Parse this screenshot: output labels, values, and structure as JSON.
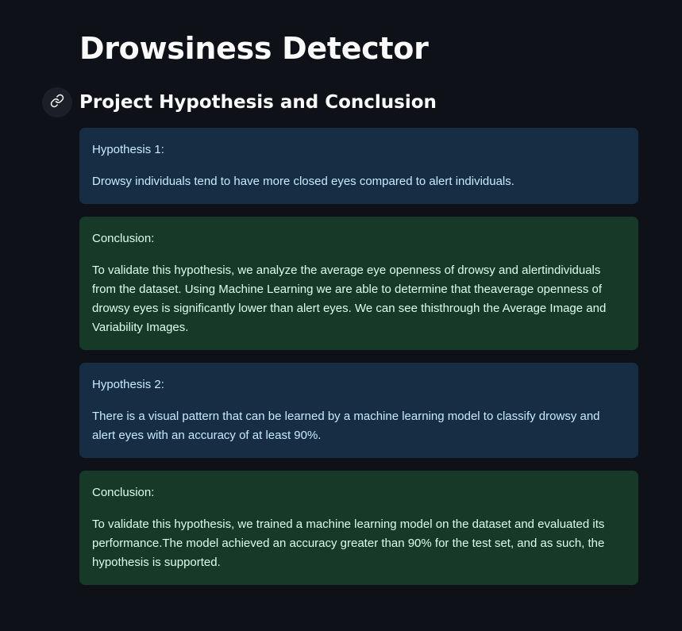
{
  "page": {
    "title": "Drowsiness Detector",
    "subtitle": "Project Hypothesis and Conclusion"
  },
  "icons": {
    "anchor": "link-icon"
  },
  "colors": {
    "background": "#0e1117",
    "info_bg": "#172d43",
    "info_text": "#c7ebff",
    "success_bg": "#173928",
    "success_text": "#dffde9"
  },
  "sections": {
    "hypothesis_1": {
      "label": "Hypothesis 1:",
      "text": "Drowsy individuals tend to have more closed eyes compared to alert individuals."
    },
    "conclusion_1": {
      "label": "Conclusion:",
      "text": "To validate this hypothesis, we analyze the average eye openness of drowsy and alertindividuals from the dataset. Using Machine Learning we are able to determine that theaverage openness of drowsy eyes is significantly lower than alert eyes. We can see thisthrough the Average Image and Variability Images."
    },
    "hypothesis_2": {
      "label": "Hypothesis 2:",
      "text": "There is a visual pattern that can be learned by a machine learning model to classify drowsy and alert eyes with an accuracy of at least 90%."
    },
    "conclusion_2": {
      "label": "Conclusion:",
      "text": "To validate this hypothesis, we trained a machine learning model on the dataset and evaluated its performance.The model achieved an accuracy greater than 90% for the test set, and as such, the hypothesis is supported."
    }
  }
}
